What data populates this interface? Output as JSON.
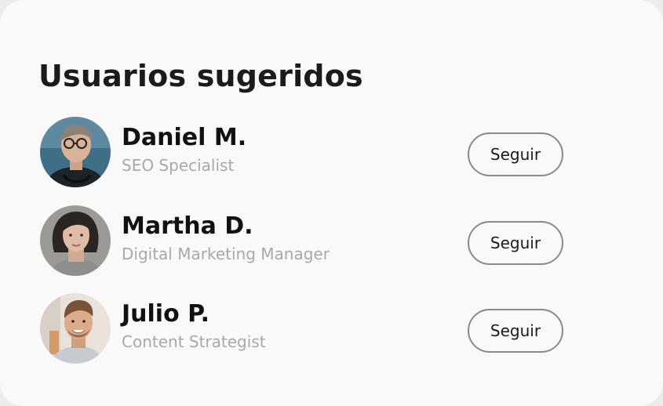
{
  "card": {
    "title": "Usuarios sugeridos"
  },
  "users": [
    {
      "name": "Daniel M.",
      "role": "SEO Specialist",
      "follow_label": "Seguir",
      "avatar": "avatar-photo-man-glasses"
    },
    {
      "name": "Martha D.",
      "role": "Digital Marketing Manager",
      "follow_label": "Seguir",
      "avatar": "avatar-photo-woman-dark-hair"
    },
    {
      "name": "Julio P.",
      "role": "Content Strategist",
      "follow_label": "Seguir",
      "avatar": "avatar-photo-smiling-man"
    }
  ],
  "colors": {
    "card_background": "#f9f9f9",
    "page_background": "#ececec",
    "title_text": "#1b1b1b",
    "name_text": "#111111",
    "role_text": "#a9a9a9",
    "button_border": "#8a8a8a"
  }
}
